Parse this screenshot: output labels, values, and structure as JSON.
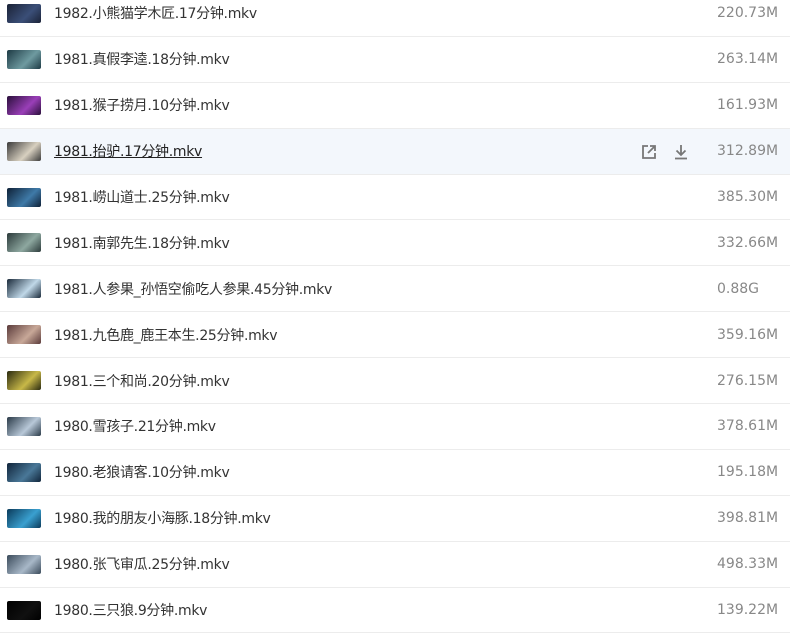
{
  "files": [
    {
      "name": "1982.小熊猫学木匠.17分钟.mkv",
      "size": "220.73M",
      "thumb_colors": [
        "#1a2236",
        "#3b4f78"
      ]
    },
    {
      "name": "1981.真假李逵.18分钟.mkv",
      "size": "263.14M",
      "thumb_colors": [
        "#1d3a44",
        "#6e9aa0"
      ]
    },
    {
      "name": "1981.猴子捞月.10分钟.mkv",
      "size": "161.93M",
      "thumb_colors": [
        "#2a0f3a",
        "#9a3fb8"
      ]
    },
    {
      "name": "1981.抬驴.17分钟.mkv",
      "size": "312.89M",
      "thumb_colors": [
        "#3a3a3a",
        "#d8d0c0"
      ]
    },
    {
      "name": "1981.崂山道士.25分钟.mkv",
      "size": "385.30M",
      "thumb_colors": [
        "#0e2036",
        "#3f7aa8"
      ]
    },
    {
      "name": "1981.南郭先生.18分钟.mkv",
      "size": "332.66M",
      "thumb_colors": [
        "#2b3a3a",
        "#8ea8a0"
      ]
    },
    {
      "name": "1981.人参果_孙悟空偷吃人参果.45分钟.mkv",
      "size": "0.88G",
      "thumb_colors": [
        "#1a2a3a",
        "#c0d8e8"
      ]
    },
    {
      "name": "1981.九色鹿_鹿王本生.25分钟.mkv",
      "size": "359.16M",
      "thumb_colors": [
        "#5a3a3a",
        "#c8a898"
      ]
    },
    {
      "name": "1981.三个和尚.20分钟.mkv",
      "size": "276.15M",
      "thumb_colors": [
        "#2a2a10",
        "#c8b848"
      ]
    },
    {
      "name": "1980.雪孩子.21分钟.mkv",
      "size": "378.61M",
      "thumb_colors": [
        "#2a3a48",
        "#b8c8d8"
      ]
    },
    {
      "name": "1980.老狼请客.10分钟.mkv",
      "size": "195.18M",
      "thumb_colors": [
        "#10243a",
        "#4a7898"
      ]
    },
    {
      "name": "1980.我的朋友小海豚.18分钟.mkv",
      "size": "398.81M",
      "thumb_colors": [
        "#0a3a5a",
        "#3aa0d0"
      ]
    },
    {
      "name": "1980.张飞审瓜.25分钟.mkv",
      "size": "498.33M",
      "thumb_colors": [
        "#3a4a5a",
        "#a8b8c8"
      ]
    },
    {
      "name": "1980.三只狼.9分钟.mkv",
      "size": "139.22M",
      "thumb_colors": [
        "#000000",
        "#101010"
      ]
    }
  ],
  "hover_row_index": 3,
  "icons": {
    "open": "open-external-icon",
    "download": "download-icon"
  }
}
